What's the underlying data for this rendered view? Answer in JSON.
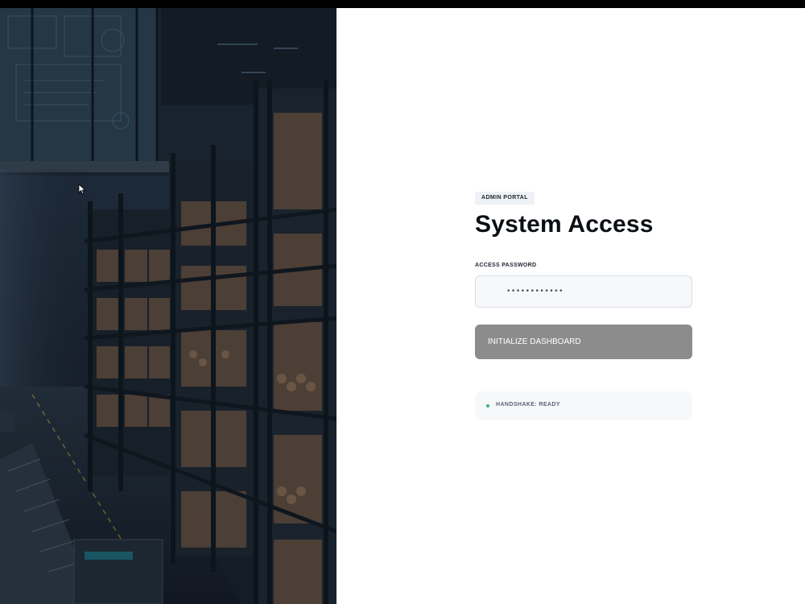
{
  "portal": {
    "badge": "ADMIN PORTAL",
    "title": "System Access",
    "password_label": "ACCESS PASSWORD",
    "password_value": "••••••••••••",
    "submit_label": "INITIALIZE DASHBOARD",
    "status_text": "HANDSHAKE: READY"
  },
  "colors": {
    "button_bg": "#8c8c8c",
    "status_dot": "#2fb57a",
    "title": "#0b0f14"
  },
  "icons": {
    "status": "status-dot-icon",
    "cursor": "mouse-pointer-icon"
  }
}
